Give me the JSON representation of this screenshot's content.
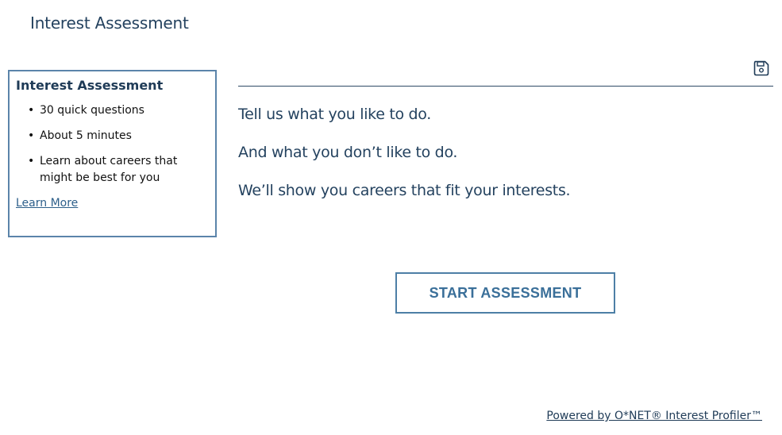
{
  "header": {
    "title": "Interest Assessment"
  },
  "info_box": {
    "title": "Interest Assessment",
    "items": [
      "30 quick questions",
      "About 5 minutes",
      "Learn about careers that might be best for you"
    ],
    "learn_more_label": "Learn More"
  },
  "toolbar": {
    "save_icon": "save-icon"
  },
  "main": {
    "lines": [
      "Tell us what you like to do.",
      "And what you don’t like to do.",
      "We’ll show you careers that fit your interests."
    ],
    "start_label": "START ASSESSMENT"
  },
  "footer": {
    "powered_by": "Powered by O*NET® Interest Profiler™"
  },
  "colors": {
    "text_primary": "#1f3b57",
    "accent": "#3a6f99",
    "border": "#5b84aa"
  }
}
